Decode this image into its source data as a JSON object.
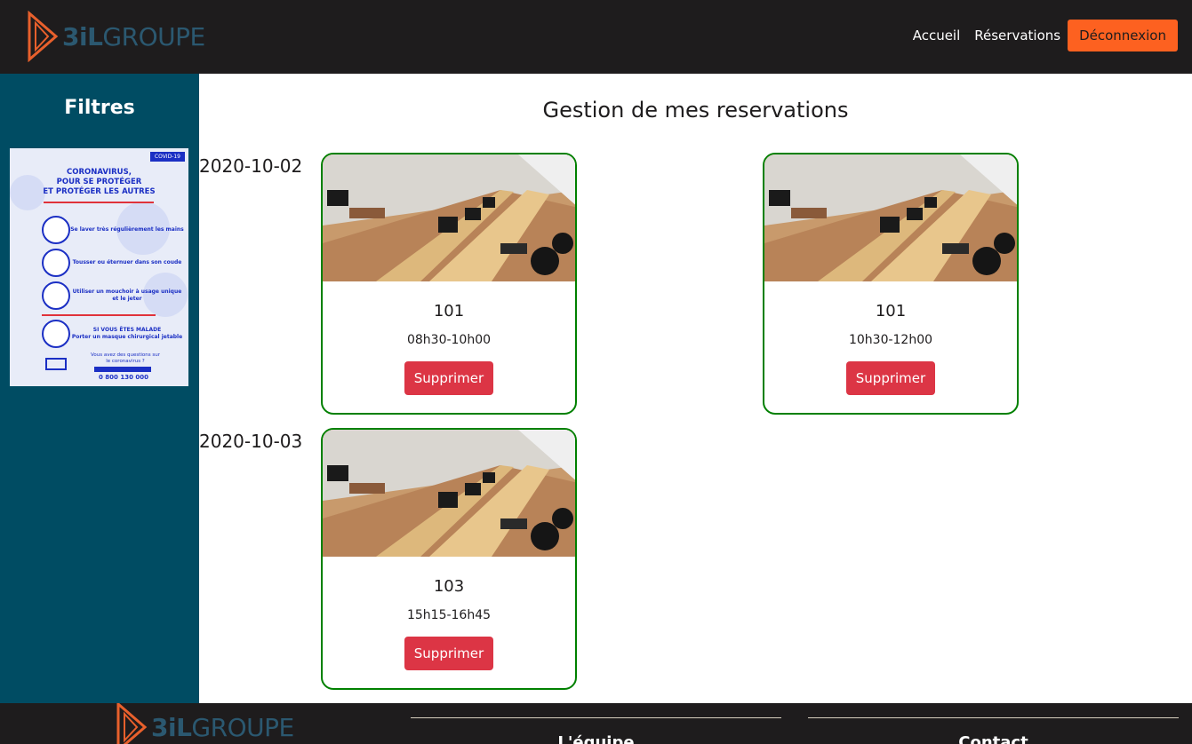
{
  "header": {
    "logo_prefix": "3iL",
    "logo_suffix": "GROUPE",
    "nav": {
      "home": "Accueil",
      "reservations": "Réservations",
      "logout": "Déconnexion"
    }
  },
  "sidebar": {
    "title": "Filtres",
    "poster": {
      "badge": "COVID-19",
      "title_line1": "CORONAVIRUS,",
      "title_line2": "POUR SE PROTÉGER",
      "title_line3": "ET PROTÉGER LES AUTRES",
      "tip1": "Se laver très régulièrement les mains",
      "tip2": "Tousser ou éternuer dans son coude",
      "tip3": "Utiliser un mouchoir à usage unique et le jeter",
      "tip4_title": "SI VOUS ÊTES MALADE",
      "tip4": "Porter un masque chirurgical jetable",
      "question": "Vous avez des questions sur le coronavirus ?",
      "phone": "0 800 130 000"
    }
  },
  "main": {
    "title": "Gestion de mes reservations",
    "groups": [
      {
        "date": "2020-10-02",
        "reservations": [
          {
            "room": "101",
            "time": "08h30-10h00",
            "delete_label": "Supprimer"
          },
          {
            "room": "101",
            "time": "10h30-12h00",
            "delete_label": "Supprimer"
          }
        ]
      },
      {
        "date": "2020-10-03",
        "reservations": [
          {
            "room": "103",
            "time": "15h15-16h45",
            "delete_label": "Supprimer"
          }
        ]
      }
    ]
  },
  "footer": {
    "logo_prefix": "3iL",
    "logo_suffix": "GROUPE",
    "team_heading": "L'équipe",
    "contact_heading": "Contact"
  },
  "colors": {
    "header_bg": "#1e1c1d",
    "sidebar_bg": "#004c63",
    "accent_orange": "#fd6120",
    "delete_red": "#dc3545",
    "card_border": "#008000"
  }
}
